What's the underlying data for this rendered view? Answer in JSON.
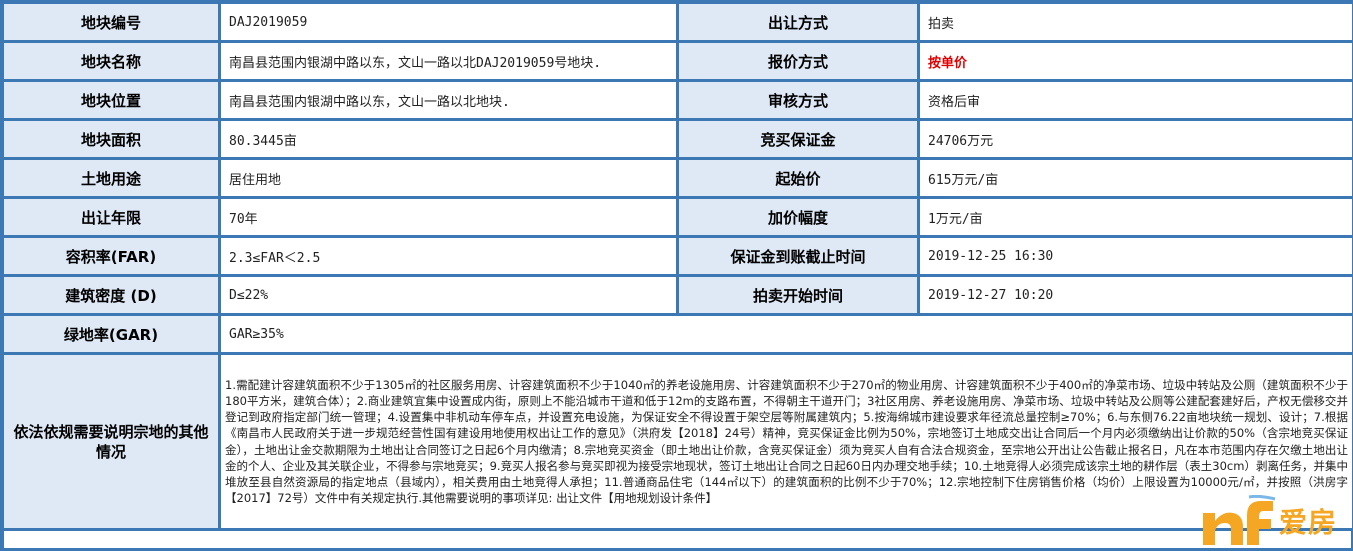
{
  "rows": [
    {
      "l1": "地块编号",
      "v1": "DAJ2019059",
      "l2": "出让方式",
      "v2": "拍卖"
    },
    {
      "l1": "地块名称",
      "v1": "南昌县范围内银湖中路以东，文山一路以北DAJ2019059号地块.",
      "l2": "报价方式",
      "v2": "按单价"
    },
    {
      "l1": "地块位置",
      "v1": "南昌县范围内银湖中路以东，文山一路以北地块.",
      "l2": "审核方式",
      "v2": "资格后审"
    },
    {
      "l1": "地块面积",
      "v1": "80.3445亩",
      "l2": "竞买保证金",
      "v2": "24706万元"
    },
    {
      "l1": "土地用途",
      "v1": "居住用地",
      "l2": "起始价",
      "v2": "615万元/亩"
    },
    {
      "l1": "出让年限",
      "v1": "70年",
      "l2": "加价幅度",
      "v2": "1万元/亩"
    },
    {
      "l1": "容积率(FAR)",
      "v1": "2.3≤FAR＜2.5",
      "l2": "保证金到账截止时间",
      "v2": "2019-12-25 16:30"
    },
    {
      "l1": "建筑密度 (D)",
      "v1": "D≤22%",
      "l2": "拍卖开始时间",
      "v2": "2019-12-27 10:20"
    },
    {
      "l1": "绿地率(GAR)",
      "v1": "GAR≥35%"
    }
  ],
  "notes": {
    "label": "依法依规需要说明宗地的其他情况",
    "text": "1.需配建计容建筑面积不少于1305㎡的社区服务用房、计容建筑面积不少于1040㎡的养老设施用房、计容建筑面积不少于270㎡的物业用房、计容建筑面积不少于400㎡的净菜市场、垃圾中转站及公厕（建筑面积不少于180平方米，建筑合体）；2.商业建筑宜集中设置成内街，原则上不能沿城市干道和低于12m的支路布置，不得朝主干道开门；3社区用房、养老设施用房、净菜市场、垃圾中转站及公厕等公建配套建好后，产权无偿移交并登记到政府指定部门统一管理；4.设置集中非机动车停车点，并设置充电设施，为保证安全不得设置于架空层等附属建筑内；5.按海绵城市建设要求年径流总量控制≥70%；6.与东侧76.22亩地块统一规划、设计；7.根据《南昌市人民政府关于进一步规范经营性国有建设用地使用权出让工作的意见》（洪府发【2018】24号）精神，竞买保证金比例为50%，宗地签订土地成交出让合同后一个月内必须缴纳出让价款的50%（含宗地竞买保证金），土地出让金交款期限为土地出让合同签订之日起6个月内缴清；8.宗地竞买资金（即土地出让价款，含竞买保证金）须为竞买人自有合法合规资金，至宗地公开出让公告截止报名日，凡在本市范围内存在欠缴土地出让金的个人、企业及其关联企业，不得参与宗地竞买；9.竞买人报名参与竞买即视为接受宗地现状，签订土地出让合同之日起60日内办理交地手续；10.土地竞得人必须完成该宗土地的耕作层（表土30cm）剥离任务，并集中堆放至县自然资源局的指定地点（县域内），相关费用由土地竞得人承担；11.普通商品住宅（144㎡以下）的建筑面积的比例不少于70%；12.宗地控制下住房销售价格（均价）上限设置为10000元/㎡，并按照（洪房字【2017】72号）文件中有关规定执行.其他需要说明的事项详见: 出让文件【用地规划设计条件】"
  },
  "watermark": {
    "text": "爱房",
    "color": "#f5a623"
  }
}
